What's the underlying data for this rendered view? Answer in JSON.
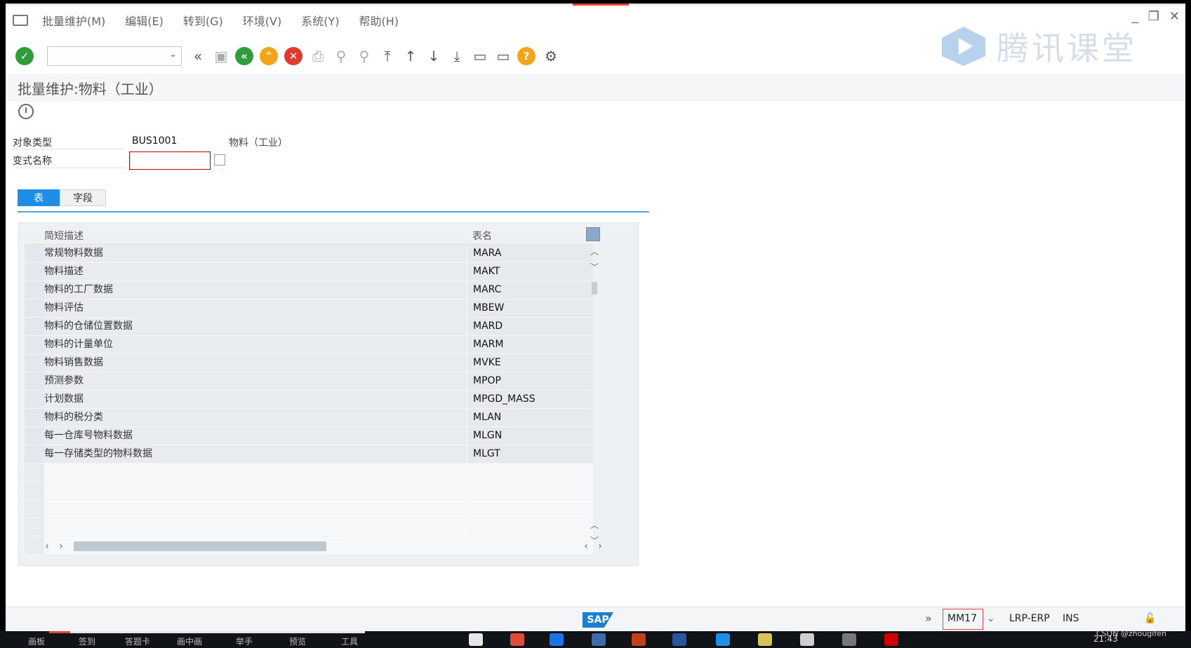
{
  "menubar": {
    "items": [
      "批量维护(M)",
      "编辑(E)",
      "转到(G)",
      "环境(V)",
      "系统(Y)",
      "帮助(H)"
    ]
  },
  "toolbar": {
    "command_value": ""
  },
  "watermark": "腾讯课堂",
  "page": {
    "title": "批量维护:物料（工业）"
  },
  "form": {
    "object_type_label": "对象类型",
    "object_type_value": "BUS1001",
    "object_type_desc": "物料（工业）",
    "variant_label": "变式名称",
    "variant_value": ""
  },
  "tabs": [
    "表",
    "字段"
  ],
  "table": {
    "headers": [
      "简短描述",
      "表名"
    ],
    "rows": [
      {
        "desc": "常规物料数据",
        "name": "MARA"
      },
      {
        "desc": "物料描述",
        "name": "MAKT"
      },
      {
        "desc": "物料的工厂数据",
        "name": "MARC"
      },
      {
        "desc": "物料评估",
        "name": "MBEW"
      },
      {
        "desc": "物料的仓储位置数据",
        "name": "MARD"
      },
      {
        "desc": "物料的计量单位",
        "name": "MARM"
      },
      {
        "desc": "物料销售数据",
        "name": "MVKE"
      },
      {
        "desc": "预测参数",
        "name": "MPOP"
      },
      {
        "desc": "计划数据",
        "name": "MPGD_MASS"
      },
      {
        "desc": "物料的税分类",
        "name": "MLAN"
      },
      {
        "desc": "每一仓库号物料数据",
        "name": "MLGN"
      },
      {
        "desc": "每一存储类型的物料数据",
        "name": "MLGT"
      }
    ]
  },
  "statusbar": {
    "sap": "SAP",
    "tcode": "MM17",
    "system": "LRP-ERP",
    "mode": "INS"
  },
  "taskbar": {
    "items": [
      "画板",
      "签到",
      "答题卡",
      "画中画",
      "举手",
      "预览",
      "工具"
    ],
    "time": "21:43",
    "credit": "CSDN @zhougifen"
  },
  "colors": {
    "accent": "#1e8ee6",
    "ok": "#2e9d3a",
    "back": "#2e9d3a",
    "exit": "#f0a51a",
    "cancel": "#e03a2e"
  }
}
